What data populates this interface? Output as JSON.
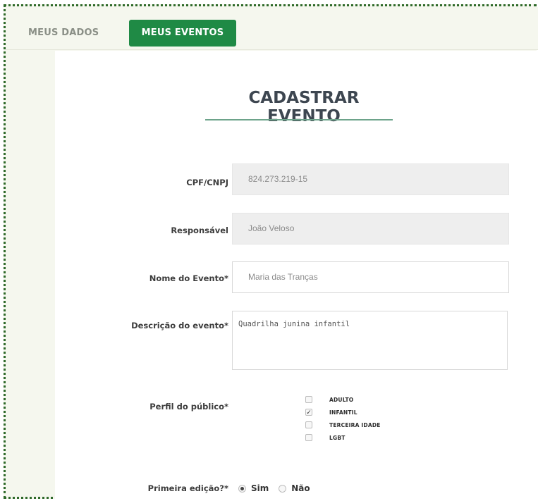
{
  "tabs": [
    {
      "label": "MEUS DADOS",
      "active": false
    },
    {
      "label": "MEUS EVENTOS",
      "active": true
    }
  ],
  "colors": {
    "accent": "#1f8a45",
    "underline": "#6da38a",
    "background": "#f5f7ee"
  },
  "form": {
    "title": "CADASTRAR EVENTO",
    "cpf": {
      "label": "CPF/CNPJ",
      "value": "824.273.219-15"
    },
    "responsavel": {
      "label": "Responsável",
      "value": "João Veloso"
    },
    "nome": {
      "label": "Nome do Evento*",
      "value": "Maria das Tranças"
    },
    "descricao": {
      "label": "Descrição do evento*",
      "value": "Quadrilha junina infantil"
    },
    "perfil": {
      "label": "Perfil do público*",
      "options": [
        {
          "label": "ADULTO",
          "checked": false
        },
        {
          "label": "INFANTIL",
          "checked": true
        },
        {
          "label": "TERCEIRA IDADE",
          "checked": false
        },
        {
          "label": "LGBT",
          "checked": false
        }
      ]
    },
    "primeira_edicao": {
      "label": "Primeira edição?*",
      "options": [
        {
          "label": "Sim",
          "selected": true
        },
        {
          "label": "Não",
          "selected": false
        }
      ]
    }
  }
}
